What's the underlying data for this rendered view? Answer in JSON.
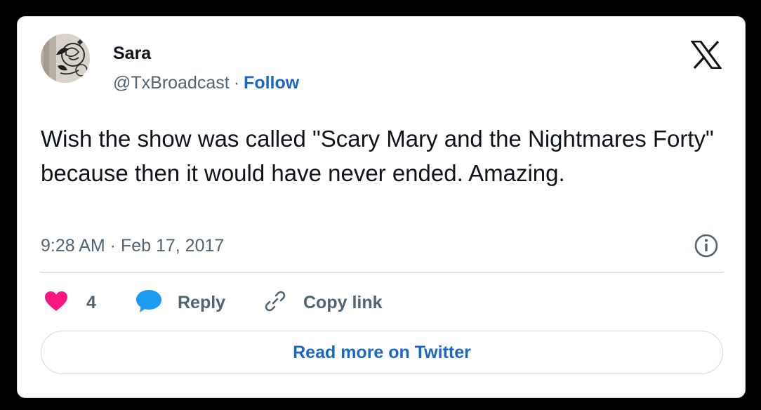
{
  "author": {
    "name": "Sara",
    "handle": "@TxBroadcast",
    "separator": "·",
    "follow_label": "Follow"
  },
  "tweet": {
    "text": "Wish the show was called \"Scary Mary and the Nightmares Forty\" because then it would have never ended. Amazing.",
    "timestamp": "9:28 AM · Feb 17, 2017"
  },
  "actions": {
    "like_count": "4",
    "reply_label": "Reply",
    "copy_link_label": "Copy link"
  },
  "read_more_label": "Read more on Twitter",
  "icons": {
    "brand": "x-logo-icon",
    "like": "heart-icon",
    "reply": "speech-bubble-icon",
    "copy": "link-icon",
    "info": "info-icon"
  },
  "colors": {
    "heart": "#f91880",
    "reply_bubble": "#1d9bf0",
    "link_blue": "#1d67c4",
    "secondary_text": "#536471",
    "primary_text": "#0f1419",
    "border": "#cfd9de"
  }
}
